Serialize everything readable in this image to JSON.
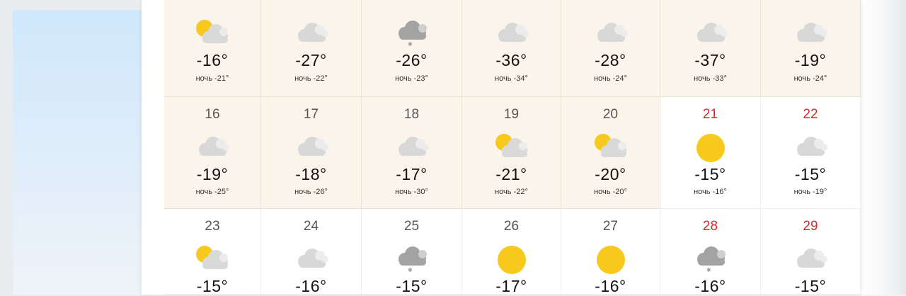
{
  "colors": {
    "warm_bg": "#fbf4ea",
    "weekend_red": "#d42a2a",
    "sun": "#f7c91c",
    "cloud": "#d8d8d8",
    "cloud_dark": "#a8a8a8"
  },
  "rows": [
    {
      "days": [
        {
          "day": "",
          "temp": "-16°",
          "night": "ночь -21°",
          "icon": "sun-cloud",
          "weekend": false
        },
        {
          "day": "",
          "temp": "-27°",
          "night": "ночь -22°",
          "icon": "cloud",
          "weekend": false
        },
        {
          "day": "",
          "temp": "-26°",
          "night": "ночь -23°",
          "icon": "cloud-snow",
          "weekend": false
        },
        {
          "day": "",
          "temp": "-36°",
          "night": "ночь -34°",
          "icon": "cloud",
          "weekend": false
        },
        {
          "day": "",
          "temp": "-28°",
          "night": "ночь -24°",
          "icon": "cloud",
          "weekend": false
        },
        {
          "day": "",
          "temp": "-37°",
          "night": "ночь -33°",
          "icon": "cloud",
          "weekend": false
        },
        {
          "day": "",
          "temp": "-19°",
          "night": "ночь -24°",
          "icon": "cloud",
          "weekend": false
        }
      ]
    },
    {
      "days": [
        {
          "day": "16",
          "temp": "-19°",
          "night": "ночь -25°",
          "icon": "cloud",
          "weekend": false
        },
        {
          "day": "17",
          "temp": "-18°",
          "night": "ночь -26°",
          "icon": "cloud",
          "weekend": false
        },
        {
          "day": "18",
          "temp": "-17°",
          "night": "ночь -30°",
          "icon": "cloud",
          "weekend": false
        },
        {
          "day": "19",
          "temp": "-21°",
          "night": "ночь -22°",
          "icon": "sun-cloud",
          "weekend": false
        },
        {
          "day": "20",
          "temp": "-20°",
          "night": "ночь -20°",
          "icon": "sun-cloud",
          "weekend": false
        },
        {
          "day": "21",
          "temp": "-15°",
          "night": "ночь -16°",
          "icon": "sun",
          "weekend": true
        },
        {
          "day": "22",
          "temp": "-15°",
          "night": "ночь -19°",
          "icon": "cloud",
          "weekend": true
        }
      ]
    },
    {
      "days": [
        {
          "day": "23",
          "temp": "-15°",
          "night": "",
          "icon": "sun-cloud",
          "weekend": false
        },
        {
          "day": "24",
          "temp": "-16°",
          "night": "",
          "icon": "cloud",
          "weekend": false
        },
        {
          "day": "25",
          "temp": "-15°",
          "night": "",
          "icon": "cloud-snow",
          "weekend": false
        },
        {
          "day": "26",
          "temp": "-17°",
          "night": "",
          "icon": "sun",
          "weekend": false
        },
        {
          "day": "27",
          "temp": "-16°",
          "night": "",
          "icon": "sun",
          "weekend": false
        },
        {
          "day": "28",
          "temp": "-16°",
          "night": "",
          "icon": "cloud-snow",
          "weekend": true
        },
        {
          "day": "29",
          "temp": "-15°",
          "night": "",
          "icon": "cloud",
          "weekend": true
        }
      ]
    }
  ]
}
